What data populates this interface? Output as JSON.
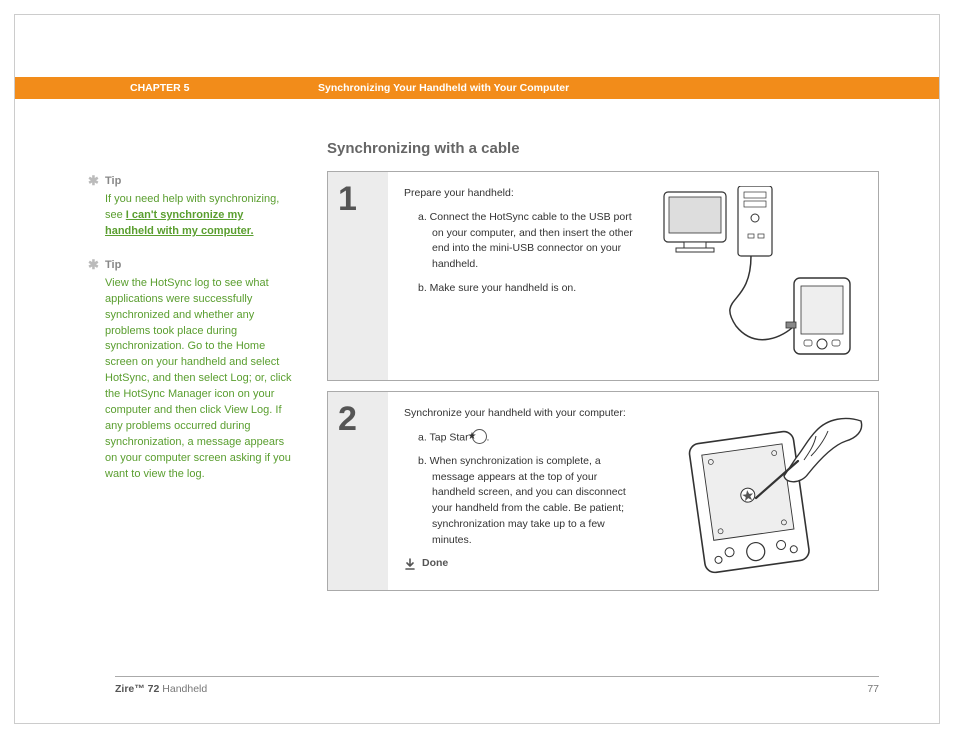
{
  "header": {
    "chapter": "CHAPTER 5",
    "title": "Synchronizing Your Handheld with Your Computer"
  },
  "section_title": "Synchronizing with a cable",
  "tips": [
    {
      "label": "Tip",
      "prefix": "If you need help with synchronizing, see ",
      "link": "I can't synchronize my handheld with my computer."
    },
    {
      "label": "Tip",
      "body": "View the HotSync log to see what applications were successfully synchronized and whether any problems took place during synchronization. Go to the Home screen on your handheld and select HotSync, and then select Log; or, click the HotSync Manager icon on your computer and then click View Log. If any problems occurred during synchronization, a message appears on your computer screen asking if you want to view the log."
    }
  ],
  "steps": [
    {
      "num": "1",
      "intro": "Prepare your handheld:",
      "items": [
        "a.  Connect the HotSync cable to the USB port on your computer, and then insert the other end into the mini-USB connector on your handheld.",
        "b.  Make sure your handheld is on."
      ]
    },
    {
      "num": "2",
      "intro": "Synchronize your handheld with your computer:",
      "items_a_prefix": "a.  Tap Star ",
      "items_a_suffix": ".",
      "items_b": "b.  When synchronization is complete, a message appears at the top of your handheld screen, and you can disconnect your handheld from the cable. Be patient; synchronization may take up to a few minutes.",
      "done": "Done"
    }
  ],
  "footer": {
    "product_bold": "Zire™ 72",
    "product_rest": " Handheld",
    "page": "77"
  }
}
